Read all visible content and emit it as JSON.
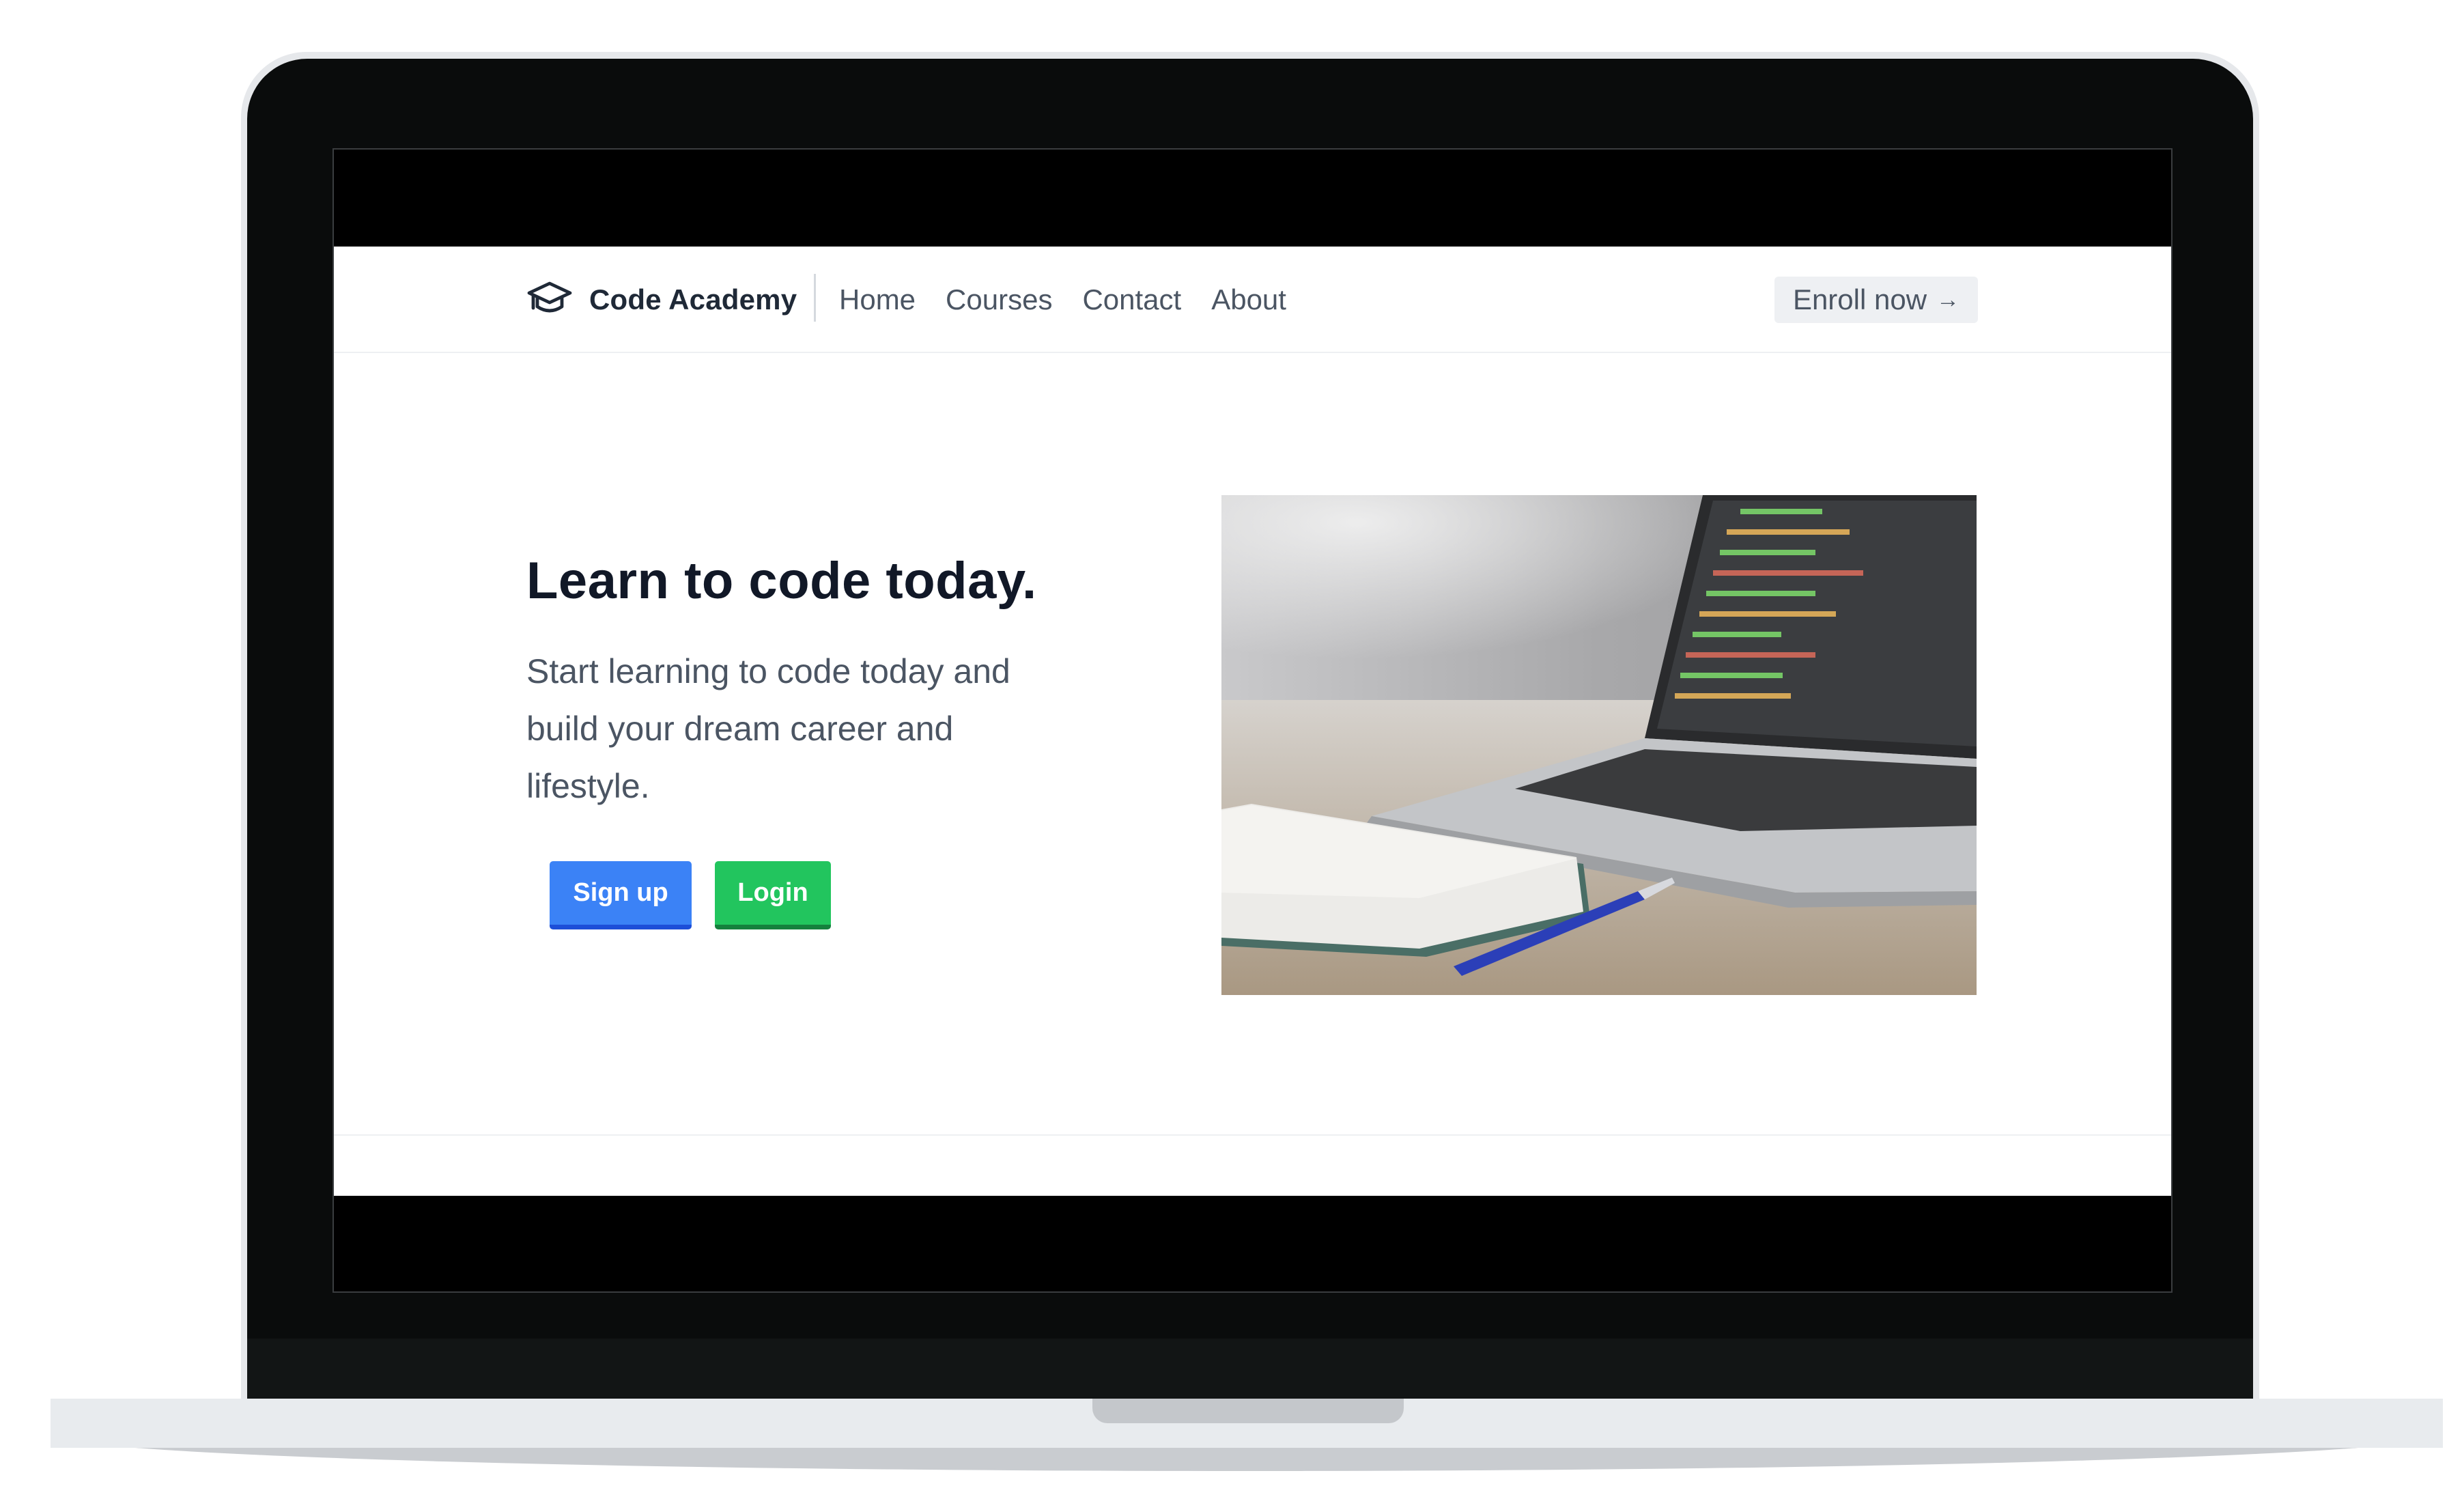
{
  "brand": {
    "name": "Code Academy",
    "icon": "graduation-cap-icon"
  },
  "nav": {
    "links": [
      "Home",
      "Courses",
      "Contact",
      "About"
    ],
    "cta_label": "Enroll now",
    "cta_icon": "arrow-right-icon"
  },
  "hero": {
    "title": "Learn to code today.",
    "text": "Start learning to code today and build your dream career and lifestyle.",
    "signup_label": "Sign up",
    "login_label": "Login",
    "image_subject": "laptop-with-code-notebook-pen"
  },
  "colors": {
    "signup": "#3b82f6",
    "login": "#22c55e",
    "text_dark": "#111827",
    "text_muted": "#4b5563"
  }
}
